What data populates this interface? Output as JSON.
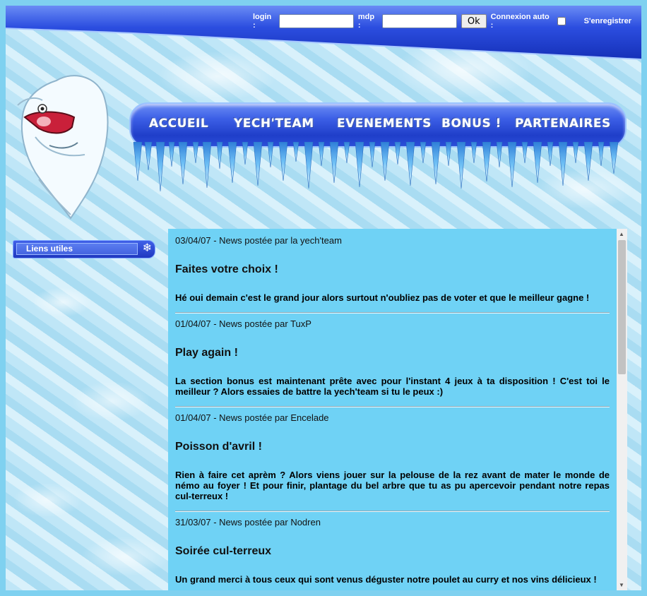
{
  "login": {
    "login_label": "login :",
    "login_value": "",
    "mdp_label": "mdp :",
    "mdp_value": "",
    "ok_label": "Ok",
    "auto_label": "Connexion auto :",
    "register_label": "S'enregistrer"
  },
  "nav": {
    "items": [
      "Accueil",
      "Yech'team",
      "Evenements",
      "Bonus !",
      "Partenaires"
    ]
  },
  "sidebar": {
    "title": "Liens utiles",
    "icon": "snowflake-icon"
  },
  "posts": [
    {
      "meta": "03/04/07 - News postée par la yech'team",
      "title": "Faites votre choix !",
      "body": "Hé oui demain c'est le grand jour alors surtout n'oubliez pas de voter et que le meilleur gagne !"
    },
    {
      "meta": "01/04/07 - News postée par TuxP",
      "title": "Play again !",
      "body": "La section bonus est maintenant prête avec pour l'instant 4 jeux à ta disposition ! C'est toi le meilleur ? Alors essaies de battre la yech'team si tu le peux :)"
    },
    {
      "meta": "01/04/07 - News postée par Encelade",
      "title": "Poisson d'avril !",
      "body": "Rien à faire cet aprèm ? Alors viens jouer sur la pelouse de la rez avant de mater le monde de némo au foyer ! Et pour finir, plantage du bel arbre que tu as pu apercevoir pendant notre repas cul-terreux !"
    },
    {
      "meta": "31/03/07 - News postée par Nodren",
      "title": "Soirée cul-terreux",
      "body": "Un grand merci à tous ceux qui sont venus déguster notre poulet au curry et nos vins délicieux !"
    }
  ],
  "colors": {
    "bar_blue": "#1f3ec9",
    "content_bg": "#6fd2f5",
    "page_bg": "#7fd1f0"
  }
}
